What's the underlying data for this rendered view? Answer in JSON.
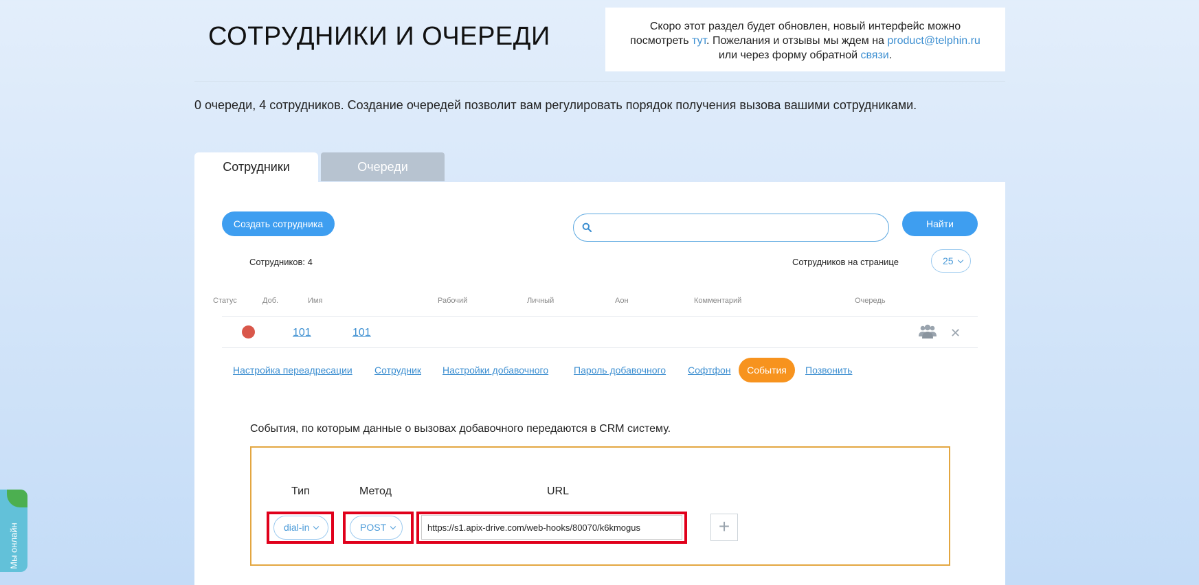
{
  "page": {
    "title": "СОТРУДНИКИ И ОЧЕРЕДИ",
    "summary": "0 очереди, 4 сотрудников. Создание очередей позволит вам регулировать порядок получения вызова вашими сотрудниками."
  },
  "notice": {
    "line1": "Скоро этот раздел будет обновлен, новый интерфейс можно",
    "line2_pre": "посмотреть ",
    "link_here": "тут",
    "line2_mid": ". Пожелания и отзывы мы ждем на ",
    "email": "product@telphin.ru",
    "line3_pre": "или через форму обратной ",
    "link_feedback": "связи",
    "line3_post": "."
  },
  "tabs": [
    {
      "label": "Сотрудники",
      "active": true
    },
    {
      "label": "Очереди",
      "active": false
    }
  ],
  "toolbar": {
    "create_label": "Создать сотрудника",
    "search_value": "",
    "search_icon": "search-icon",
    "find_label": "Найти"
  },
  "list": {
    "count_label": "Сотрудников: 4",
    "per_page_label": "Сотрудников на странице",
    "per_page_value": "25"
  },
  "table": {
    "headers": [
      "Статус",
      "Доб.",
      "Имя",
      "Рабочий",
      "Личный",
      "Аон",
      "Комментарий",
      "Очередь"
    ],
    "rows": [
      {
        "status_color": "#d9574a",
        "ext": "101",
        "name": "101"
      }
    ]
  },
  "subtabs": [
    "Настройка переадресации",
    "Сотрудник",
    "Настройки добавочного",
    "Пароль добавочного",
    "Софтфон",
    "События",
    "Позвонить"
  ],
  "active_subtab": "События",
  "events": {
    "description": "События, по которым данные о вызовах добавочного передаются в CRM систему.",
    "col_type": "Тип",
    "col_method": "Метод",
    "col_url": "URL",
    "type_value": "dial-in",
    "method_value": "POST",
    "url_value": "https://s1.apix-drive.com/web-hooks/80070/k6kmogus",
    "add_symbol": "+"
  },
  "widget": {
    "label": "Мы онлайн"
  },
  "colors": {
    "accent": "#3e9ef0",
    "active_subtab": "#f7931e",
    "highlight": "#e0001b",
    "events_border": "#e3a640"
  }
}
